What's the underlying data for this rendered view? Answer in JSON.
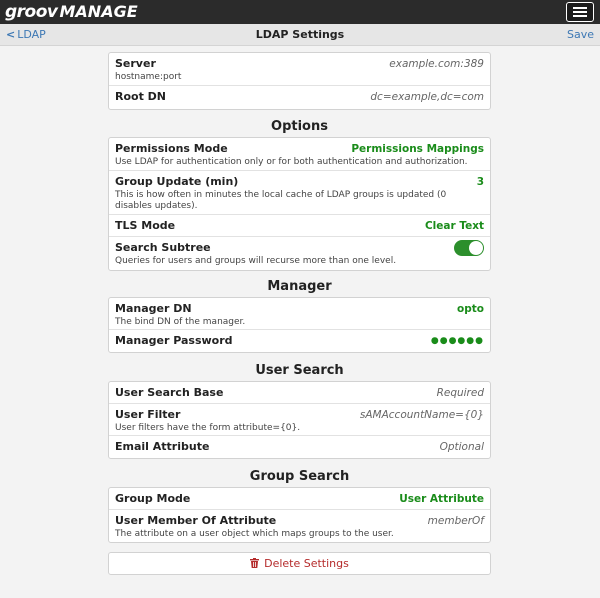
{
  "app": {
    "logo_part1": "groov",
    "logo_part2": "MANAGE"
  },
  "nav": {
    "back_label": "LDAP",
    "title": "LDAP Settings",
    "save_label": "Save"
  },
  "server_group": {
    "server": {
      "label": "Server",
      "desc": "hostname:port",
      "placeholder": "example.com:389"
    },
    "root_dn": {
      "label": "Root DN",
      "placeholder": "dc=example,dc=com"
    }
  },
  "options": {
    "title": "Options",
    "permissions_mode": {
      "label": "Permissions Mode",
      "desc": "Use LDAP for authentication only or for both authentication and authorization.",
      "value": "Permissions Mappings"
    },
    "group_update": {
      "label": "Group Update (min)",
      "desc": "This is how often in minutes the local cache of LDAP groups is updated (0 disables updates).",
      "value": "3"
    },
    "tls_mode": {
      "label": "TLS Mode",
      "value": "Clear Text"
    },
    "search_subtree": {
      "label": "Search Subtree",
      "desc": "Queries for users and groups will recurse more than one level.",
      "enabled": true
    }
  },
  "manager": {
    "title": "Manager",
    "manager_dn": {
      "label": "Manager DN",
      "desc": "The bind DN of the manager.",
      "value": "opto"
    },
    "manager_password": {
      "label": "Manager Password",
      "value": "●●●●●●"
    }
  },
  "user_search": {
    "title": "User Search",
    "user_search_base": {
      "label": "User Search Base",
      "placeholder": "Required"
    },
    "user_filter": {
      "label": "User Filter",
      "desc": "User filters have the form attribute={0}.",
      "placeholder": "sAMAccountName={0}"
    },
    "email_attribute": {
      "label": "Email Attribute",
      "placeholder": "Optional"
    }
  },
  "group_search": {
    "title": "Group Search",
    "group_mode": {
      "label": "Group Mode",
      "value": "User Attribute"
    },
    "user_member_of": {
      "label": "User Member Of Attribute",
      "desc": "The attribute on a user object which maps groups to the user.",
      "placeholder": "memberOf"
    }
  },
  "actions": {
    "delete_label": "Delete Settings"
  },
  "colors": {
    "accent_green": "#1a8c1a",
    "link_blue": "#3d78b4",
    "danger_red": "#b52a2a",
    "topbar": "#2b2b2b"
  }
}
